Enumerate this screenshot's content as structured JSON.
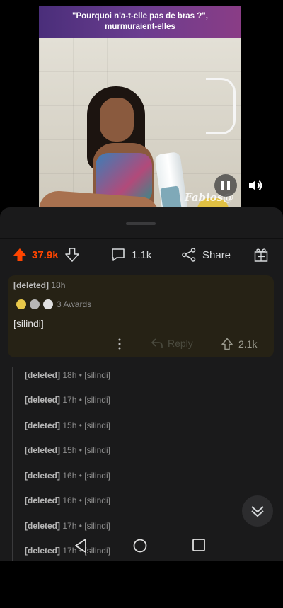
{
  "video": {
    "caption_line1": "\"Pourquoi n'a-t-elle pas de bras ?\",",
    "caption_line2": "murmuraient-elles",
    "watermark": "Fabios@"
  },
  "actions": {
    "upvotes": "37.9k",
    "comments": "1.1k",
    "share_label": "Share"
  },
  "top_comment": {
    "author": "[deleted]",
    "age": "18h",
    "awards_label": "3 Awards",
    "body": "[silindi]",
    "reply_label": "Reply",
    "score": "2.1k"
  },
  "replies": [
    {
      "author": "[deleted]",
      "age": "18h",
      "body": "[silindi]"
    },
    {
      "author": "[deleted]",
      "age": "17h",
      "body": "[silindi]"
    },
    {
      "author": "[deleted]",
      "age": "15h",
      "body": "[silindi]"
    },
    {
      "author": "[deleted]",
      "age": "15h",
      "body": "[silindi]"
    },
    {
      "author": "[deleted]",
      "age": "16h",
      "body": "[silindi]"
    },
    {
      "author": "[deleted]",
      "age": "16h",
      "body": "[silindi]"
    },
    {
      "author": "[deleted]",
      "age": "17h",
      "body": "[silindi]"
    },
    {
      "author": "[deleted]",
      "age": "17h",
      "body": "[silindi]"
    }
  ],
  "colors": {
    "upvote_active": "#ff4500",
    "sheet_bg": "#1a1a1b",
    "highlight_card": "#262215"
  },
  "icons": {
    "upvote": "arrow-up-icon",
    "downvote": "arrow-down-icon",
    "comments": "comment-bubble-icon",
    "share": "share-icon",
    "award": "gift-icon",
    "more": "more-vertical-icon",
    "reply": "reply-icon",
    "collapse": "chevrons-down-icon",
    "pause": "pause-icon",
    "volume": "volume-icon"
  }
}
